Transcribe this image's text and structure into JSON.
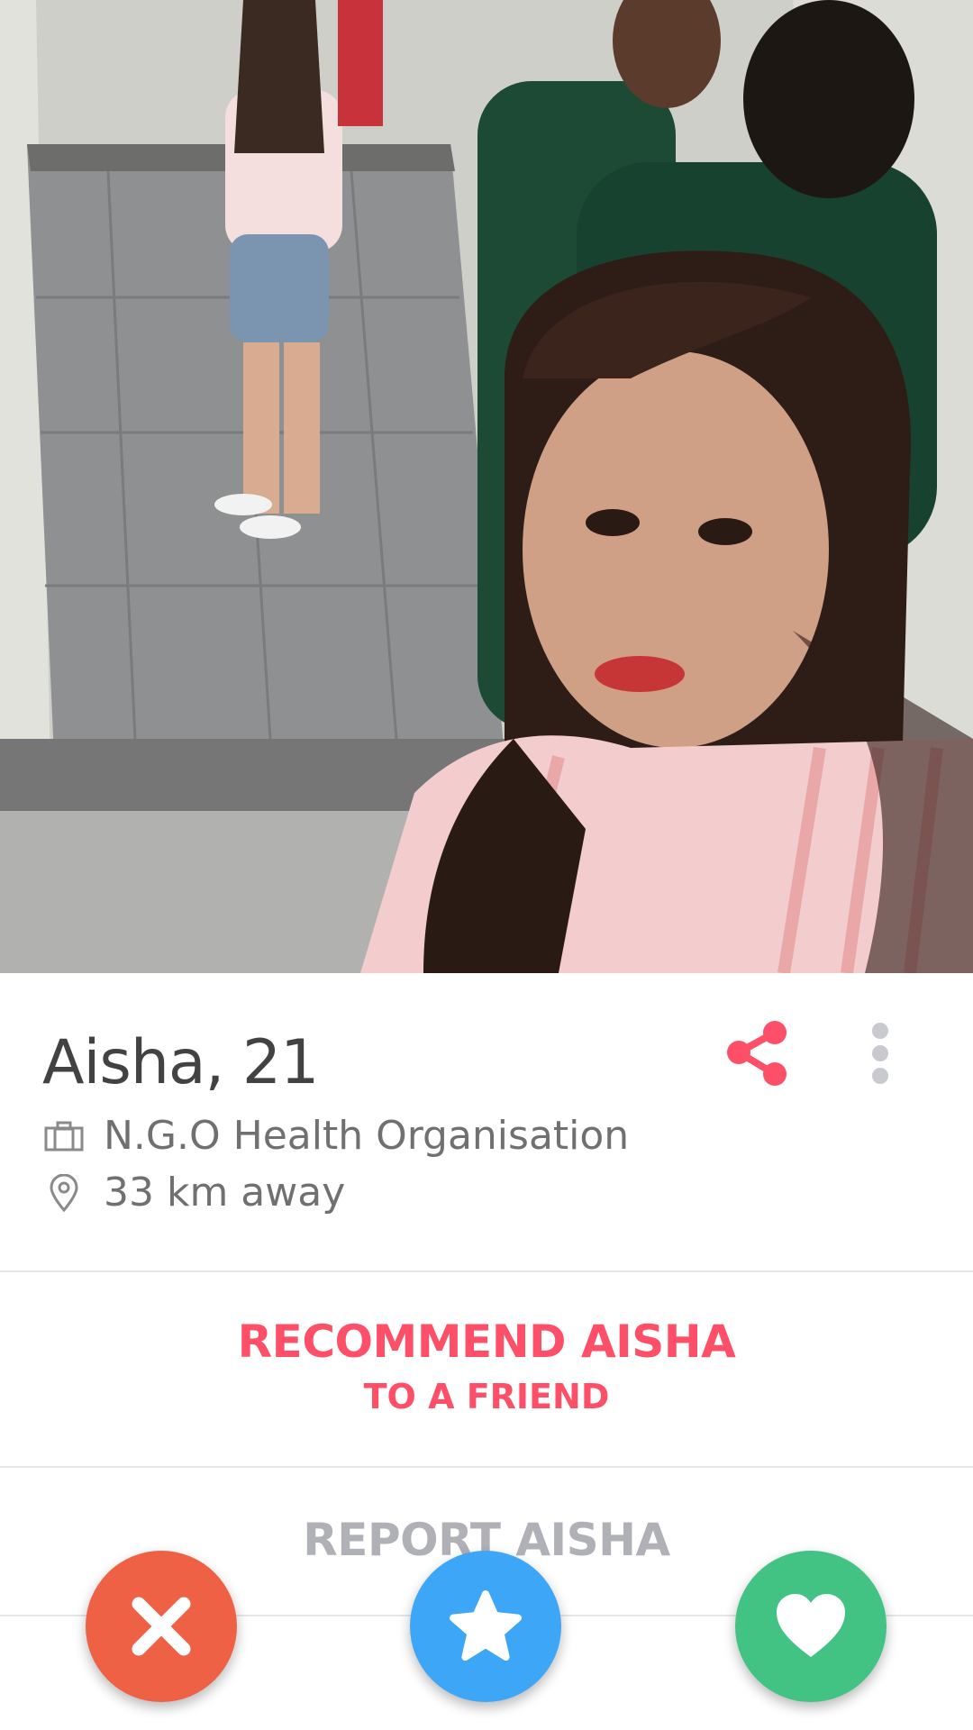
{
  "profile": {
    "name_age": "Aisha, 21",
    "job": "N.G.O Health Organisation",
    "distance": "33 km away"
  },
  "recommend": {
    "line1": "RECOMMEND AISHA",
    "line2": "TO A FRIEND"
  },
  "report_label": "REPORT AISHA",
  "icons": {
    "share": "share-icon",
    "more": "more-vertical-icon",
    "job": "briefcase-icon",
    "location": "location-pin-icon",
    "nope": "close-icon",
    "superlike": "star-icon",
    "like": "heart-icon"
  },
  "colors": {
    "accent": "#fd5068",
    "nope": "#ef6145",
    "superlike": "#3ea6f6",
    "like": "#42c384"
  }
}
